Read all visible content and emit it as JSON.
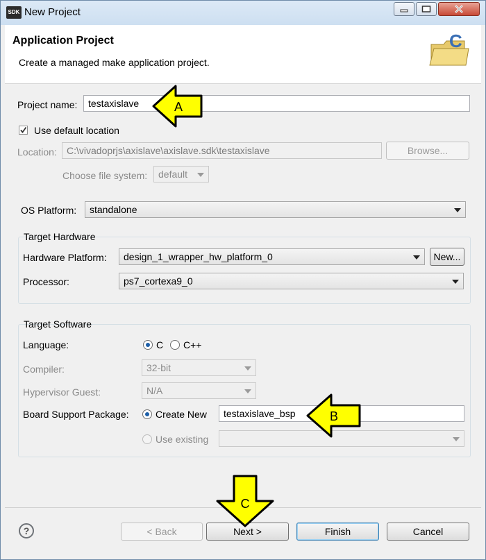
{
  "window": {
    "app_icon_text": "SDK",
    "title": "New Project"
  },
  "header": {
    "title": "Application Project",
    "description": "Create a managed make application project."
  },
  "project": {
    "name_label": "Project name:",
    "name_value": "testaxislave",
    "use_default_label": "Use default location",
    "use_default_checked": true,
    "location_label": "Location:",
    "location_value": "C:\\vivadoprjs\\axislave\\axislave.sdk\\testaxislave",
    "browse_label": "Browse...",
    "filesystem_label": "Choose file system:",
    "filesystem_value": "default",
    "os_label": "OS Platform:",
    "os_value": "standalone"
  },
  "hardware": {
    "group_label": "Target Hardware",
    "platform_label": "Hardware Platform:",
    "platform_value": "design_1_wrapper_hw_platform_0",
    "new_label": "New...",
    "processor_label": "Processor:",
    "processor_value": "ps7_cortexa9_0"
  },
  "software": {
    "group_label": "Target Software",
    "language_label": "Language:",
    "lang_c": "C",
    "lang_cpp": "C++",
    "compiler_label": "Compiler:",
    "compiler_value": "32-bit",
    "hypervisor_label": "Hypervisor Guest:",
    "hypervisor_value": "N/A",
    "bsp_label": "Board Support Package:",
    "create_new_label": "Create New",
    "bsp_name": "testaxislave_bsp",
    "use_existing_label": "Use existing"
  },
  "annotations": {
    "a": "A",
    "b": "B",
    "c": "C",
    "color": "#ffff00"
  },
  "footer": {
    "help": "?",
    "back": "< Back",
    "next": "Next >",
    "finish": "Finish",
    "cancel": "Cancel"
  }
}
